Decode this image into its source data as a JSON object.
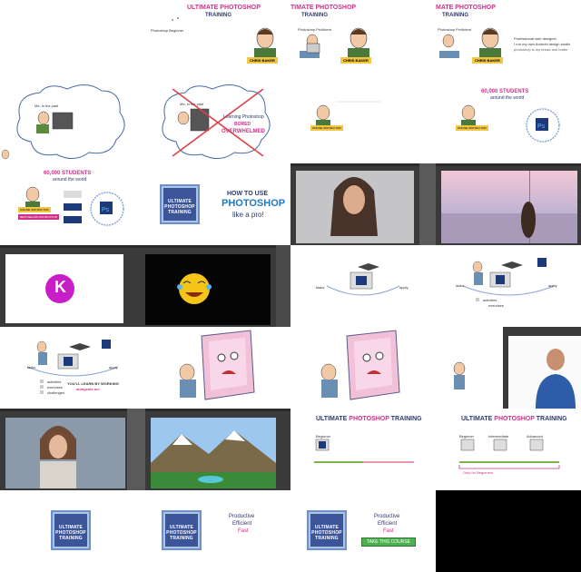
{
  "course": {
    "title_part1": "ULTIMATE",
    "title_part2": "PHOTOSHOP",
    "title_part3": "TRAINING",
    "title_short": "TIMATE PHOTOSHOP",
    "title_short2": "MATE PHOTOSHOP",
    "logo_lines": [
      "ULTIMATE",
      "PHOTOSHOP",
      "TRAINING"
    ]
  },
  "frame1": {
    "bubble": "Photoshop Beginner",
    "name": "CHRIS BAKER"
  },
  "frame2": {
    "bubble": "Photoshop Proficient",
    "name": "CHRIS BAKER"
  },
  "frame3": {
    "bubble": "Photoshop Proficient",
    "name": "CHRIS BAKER",
    "bullets": [
      "Professional web designer",
      "I run my own Android design studio",
      "photoshop is my bread and butter"
    ]
  },
  "frame4": {
    "thought": "Me, in the past"
  },
  "frame5": {
    "thought": "Me, in the past",
    "line1": "Learning Photoshop",
    "line2": "BORED",
    "line3": "OVERWHELMED"
  },
  "frame7": {
    "students": "60,000 STUDENTS",
    "sub": "around the world",
    "badge": "ONLINE INSTRUCTOR"
  },
  "frame8": {
    "students": "60,000 STUDENTS",
    "sub": "around the world",
    "badge": "ONLINE INSTRUCTOR",
    "badge2": "BESTSELLING INSTRUCTOR"
  },
  "frame9": {
    "how": "HOW TO USE",
    "ps": "PHOTOSHOP",
    "like": "like a pro!"
  },
  "frame13": {
    "k": "K"
  },
  "frame15": {
    "label1": "tasks",
    "label2": "apply"
  },
  "frame16": {
    "label1": "tasks",
    "label2": "apply",
    "list": [
      "activities",
      "exercises"
    ]
  },
  "frame17": {
    "label1": "tasks",
    "label2": "apply",
    "list": [
      "activities",
      "exercises",
      "challenges"
    ],
    "note1": "YOU'LL LEARN BY WORKING",
    "note2": "alongside me"
  },
  "frame23": {
    "levels": [
      "Beginner"
    ]
  },
  "frame24": {
    "levels": [
      "Beginner",
      "Intermediate",
      "Advanced"
    ],
    "only": "Only for Beginners"
  },
  "frame26": {
    "words": [
      "Productive",
      "Efficient",
      "Fast"
    ]
  },
  "frame27": {
    "words": [
      "Productive",
      "Efficient",
      "Fast"
    ],
    "cta": "TAKE THIS COURSE"
  },
  "colors": {
    "pink": "#d0308a",
    "navy": "#2b3a6b",
    "ps_dark": "#3a3a3a",
    "logo_blue": "#3c5599",
    "cta_green": "#4caf50"
  }
}
